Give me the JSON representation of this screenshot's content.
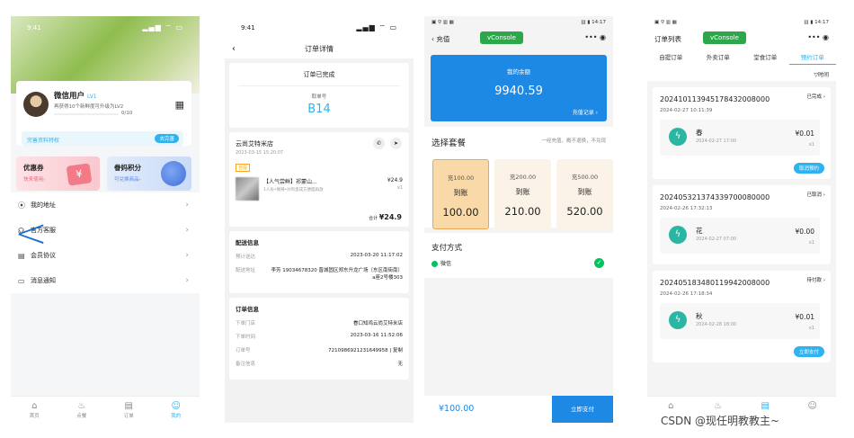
{
  "phone1": {
    "time": "9:41",
    "signal": "▂▄▆ ⌔ ▭",
    "user": {
      "name": "微信用户",
      "level": "LV1",
      "message": "再获得10个新鲜度可升级为LV2",
      "progress": "0/10"
    },
    "perk": {
      "text": "完善资料特权",
      "button": "去完善"
    },
    "cards": [
      {
        "title": "优惠券",
        "subtitle": "快来使用›",
        "icon": "¥"
      },
      {
        "title": "眷妈积分",
        "subtitle": "可兑换商品›"
      }
    ],
    "menu": [
      {
        "label": "我的地址",
        "icon": "⦿"
      },
      {
        "label": "官方客服",
        "icon": "☊"
      },
      {
        "label": "会员协议",
        "icon": "▤"
      },
      {
        "label": "消息通知",
        "icon": "▭"
      }
    ],
    "tabs": [
      {
        "label": "首页",
        "icon": "⌂"
      },
      {
        "label": "点餐",
        "icon": "♨"
      },
      {
        "label": "订单",
        "icon": "▤"
      },
      {
        "label": "我的",
        "icon": "☺"
      }
    ]
  },
  "phone2": {
    "time": "9:41",
    "signal": "▂▄▆ ⌔ ▭",
    "title": "订单详情",
    "status": "订单已完成",
    "queue_label": "取单号",
    "queue_no": "B14",
    "store": {
      "name": "云尚艾特米店",
      "date": "2023-03-15 15:20:07",
      "tag": "自提"
    },
    "goods": {
      "name": "【人气尝鲜】祁蒙山...",
      "desc": "1人份•微辣•炒鸡蛋成方便面再放",
      "price": "¥24.9",
      "qty": "x1"
    },
    "total_label": "合计",
    "total": "¥24.9",
    "delivery": {
      "title": "配送信息",
      "rows": [
        {
          "k": "预计送达",
          "v": "2023-03-20 11:17:02"
        },
        {
          "k": "配送地址",
          "v": "李芳 19034678320 晋城固区郑东升龙广场（东区南街南）a座2号楼303"
        }
      ]
    },
    "order": {
      "title": "订单信息",
      "rows": [
        {
          "k": "下单门店",
          "v": "眷口知鸡云尚艾特米店"
        },
        {
          "k": "下单时间",
          "v": "2023-03-16 11:52:06"
        },
        {
          "k": "订单号",
          "v": "7210986921231649958 | 复制"
        },
        {
          "k": "备注信息",
          "v": "无"
        }
      ]
    }
  },
  "phone3": {
    "status_left": "▣ ⚲ ▥ ▦",
    "status_right": "▥ ▮ 14:17",
    "title": "充值",
    "vconsole": "vConsole",
    "balance_label": "我的余额",
    "balance": "9940.59",
    "record": "充值记录 ›",
    "package_title": "选择套餐",
    "package_hint": "一经充值，概不退换，不兑现",
    "packages": [
      {
        "top": "充100.00",
        "mid": "到账",
        "amount": "100.00"
      },
      {
        "top": "充200.00",
        "mid": "到账",
        "amount": "210.00"
      },
      {
        "top": "充500.00",
        "mid": "到账",
        "amount": "520.00"
      }
    ],
    "pay_title": "支付方式",
    "pay_method": "微信",
    "footer_amount": "¥100.00",
    "pay_button": "立即支付"
  },
  "phone4": {
    "status_left": "▣ ⚲ ▥ ▦",
    "status_right": "▥ ▮ 14:17",
    "title": "订单列表",
    "vconsole": "vConsole",
    "tabs": [
      "自提订单",
      "外卖订单",
      "堂食订单",
      "预约订单"
    ],
    "filter": "▽时间",
    "orders": [
      {
        "no": "202410113945178432008000",
        "date": "2024-02-27 10:11:39",
        "status": "已完成 ›",
        "item": "春",
        "sub": "2024-02-27 17:00",
        "price": "¥0.01",
        "qty": "x1",
        "action": "取消预约"
      },
      {
        "no": "202405321374339700080000",
        "date": "2024-02-26 17:32:13",
        "status": "已取消 ›",
        "item": "花",
        "sub": "2024-02-27 07:00",
        "price": "¥0.00",
        "qty": "x1",
        "action": ""
      },
      {
        "no": "202405183480119942008000",
        "date": "2024-02-26 17:18:34",
        "status": "待付款 ›",
        "item": "秋",
        "sub": "2024-02-28 18:00",
        "price": "¥0.01",
        "qty": "x1",
        "action": "立即支付"
      }
    ],
    "bottom_icons": [
      "⌂",
      "♨",
      "▤",
      "☺"
    ]
  },
  "watermark": "CSDN @现任明教教主~",
  "colors": {
    "accent": "#2eb2f0",
    "pay_blue": "#1e88e5",
    "wechat_green": "#07c160",
    "vconsole_green": "#2ca84a"
  }
}
